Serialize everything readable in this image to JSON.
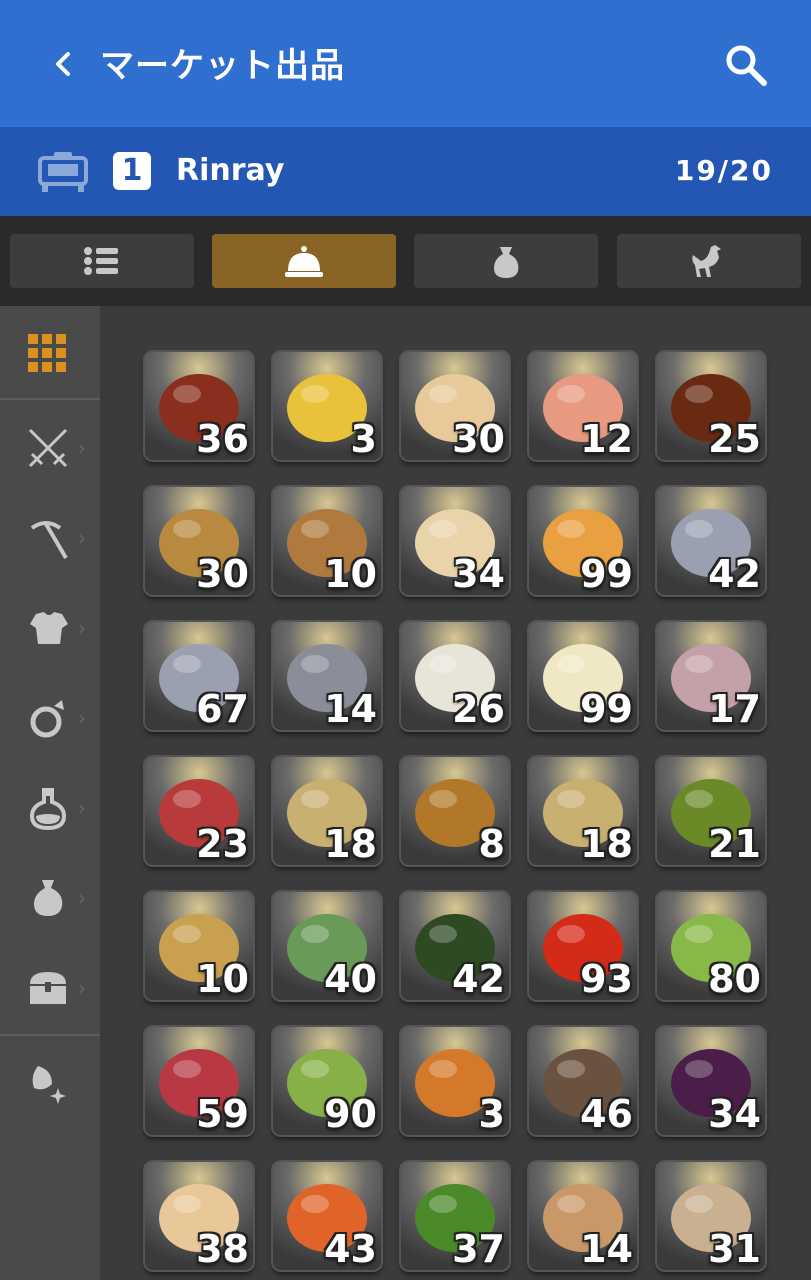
{
  "header": {
    "title": "マーケット出品",
    "back_icon": "chevron-left-icon",
    "search_icon": "search-icon"
  },
  "retainer": {
    "number": "1",
    "name": "Rinray",
    "count": "19/20",
    "icon": "retainer-bed-icon"
  },
  "tabs": [
    {
      "name": "tab-list",
      "icon": "list-icon",
      "active": false
    },
    {
      "name": "tab-food",
      "icon": "cloche-icon",
      "active": true
    },
    {
      "name": "tab-materials",
      "icon": "bag-icon",
      "active": false
    },
    {
      "name": "tab-creatures",
      "icon": "chocobo-icon",
      "active": false
    }
  ],
  "sidebar": [
    {
      "name": "sidebar-all",
      "icon": "grid-icon",
      "chevron": false,
      "active": true
    },
    {
      "name": "sidebar-weapons",
      "icon": "crossed-swords-icon",
      "chevron": true
    },
    {
      "name": "sidebar-tools",
      "icon": "pickaxe-icon",
      "chevron": true
    },
    {
      "name": "sidebar-armor",
      "icon": "armor-icon",
      "chevron": true
    },
    {
      "name": "sidebar-accessories",
      "icon": "ring-icon",
      "chevron": true
    },
    {
      "name": "sidebar-medicine",
      "icon": "flask-icon",
      "chevron": true
    },
    {
      "name": "sidebar-materials",
      "icon": "pouch-icon",
      "chevron": true
    },
    {
      "name": "sidebar-housing",
      "icon": "chest-icon",
      "chevron": true
    },
    {
      "name": "sidebar-other",
      "icon": "sparkle-icon",
      "chevron": false
    }
  ],
  "items": [
    {
      "name": "item-stew-dish",
      "qty": "36",
      "color": "#8a2e1e"
    },
    {
      "name": "item-omelette-dish",
      "qty": "3",
      "color": "#e8c23a"
    },
    {
      "name": "item-muffin",
      "qty": "30",
      "color": "#e8c99a"
    },
    {
      "name": "item-salmon-salad",
      "qty": "12",
      "color": "#e89a80"
    },
    {
      "name": "item-chocolate-cake",
      "qty": "25",
      "color": "#6a2a12"
    },
    {
      "name": "item-bread-roll",
      "qty": "30",
      "color": "#b8893e"
    },
    {
      "name": "item-cookie",
      "qty": "10",
      "color": "#b07a3e"
    },
    {
      "name": "item-loaf-bread",
      "qty": "34",
      "color": "#e8d4a8"
    },
    {
      "name": "item-soup-bowl",
      "qty": "99",
      "color": "#e8a040"
    },
    {
      "name": "item-milk-can",
      "qty": "42",
      "color": "#9aa0b0"
    },
    {
      "name": "item-milk-can-2",
      "qty": "67",
      "color": "#9aa0b0"
    },
    {
      "name": "item-milk-can-3",
      "qty": "14",
      "color": "#8a8e98"
    },
    {
      "name": "item-cream-bowl",
      "qty": "26",
      "color": "#e8e4d8"
    },
    {
      "name": "item-cheese-wedge",
      "qty": "99",
      "color": "#f0e8c4"
    },
    {
      "name": "item-fish-steak",
      "qty": "17",
      "color": "#c4a0a8"
    },
    {
      "name": "item-meat-cut",
      "qty": "23",
      "color": "#b83a3a"
    },
    {
      "name": "item-egg",
      "qty": "18",
      "color": "#c8b070"
    },
    {
      "name": "item-speckled-egg",
      "qty": "8",
      "color": "#b07828"
    },
    {
      "name": "item-egg-2",
      "qty": "18",
      "color": "#c8b070"
    },
    {
      "name": "item-herbs",
      "qty": "21",
      "color": "#6a8a28"
    },
    {
      "name": "item-potato",
      "qty": "10",
      "color": "#c8a050"
    },
    {
      "name": "item-aloe-leaf",
      "qty": "40",
      "color": "#6a9a58"
    },
    {
      "name": "item-zucchini",
      "qty": "42",
      "color": "#2e4a22"
    },
    {
      "name": "item-tomato",
      "qty": "93",
      "color": "#d42a18"
    },
    {
      "name": "item-leek",
      "qty": "80",
      "color": "#88b848"
    },
    {
      "name": "item-red-potato",
      "qty": "59",
      "color": "#b83844"
    },
    {
      "name": "item-cabbage",
      "qty": "90",
      "color": "#88b048"
    },
    {
      "name": "item-onion",
      "qty": "3",
      "color": "#d4782a"
    },
    {
      "name": "item-mandrake-root",
      "qty": "46",
      "color": "#6a5240"
    },
    {
      "name": "item-eggplant",
      "qty": "34",
      "color": "#4a1e48"
    },
    {
      "name": "item-parsnip",
      "qty": "38",
      "color": "#e8c898"
    },
    {
      "name": "item-carrot",
      "qty": "43",
      "color": "#e0642a"
    },
    {
      "name": "item-chives",
      "qty": "37",
      "color": "#4a8a28"
    },
    {
      "name": "item-bamboo-shoot",
      "qty": "14",
      "color": "#c89868"
    },
    {
      "name": "item-mushrooms",
      "qty": "31",
      "color": "#c8b090"
    }
  ]
}
